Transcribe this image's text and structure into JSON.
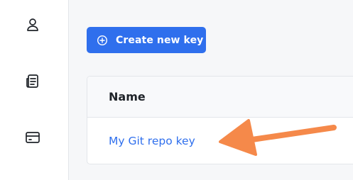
{
  "sidebar": {
    "items": [
      {
        "icon": "users-icon"
      },
      {
        "icon": "document-icon"
      },
      {
        "icon": "credit-card-icon"
      }
    ]
  },
  "toolbar": {
    "create_label": "Create new key",
    "create_icon": "plus-circle-icon"
  },
  "keys_table": {
    "columns": [
      "Name"
    ],
    "rows": [
      {
        "name": "My Git repo key"
      }
    ]
  },
  "annotation": {
    "arrow_color": "#f5894a"
  },
  "colors": {
    "accent": "#2f6fed",
    "background": "#f6f7f9"
  }
}
